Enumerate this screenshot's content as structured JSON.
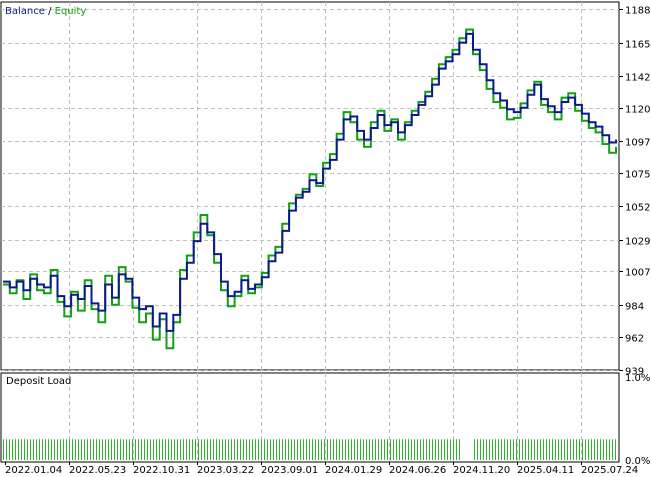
{
  "legend": {
    "balance": "Balance",
    "separator": " / ",
    "equity": "Equity"
  },
  "sub_title": "Deposit Load",
  "colors": {
    "balance": "#0a1a8c",
    "equity": "#11a011",
    "load": "#2fb32f",
    "grid": "#c0c0c0",
    "frame": "#000000"
  },
  "chart_data": [
    {
      "type": "line",
      "title": "",
      "x_ticks": [
        "2022.01.04",
        "2022.05.23",
        "2022.10.31",
        "2023.03.22",
        "2023.09.01",
        "2024.01.29",
        "2024.06.26",
        "2024.11.20",
        "2025.04.11",
        "2025.07.24"
      ],
      "y_ticks": [
        1188,
        1165,
        1142,
        1120,
        1097,
        1075,
        1052,
        1029,
        1007,
        984,
        962,
        939
      ],
      "ylim": [
        939,
        1193
      ],
      "grid": true,
      "series": [
        {
          "name": "Balance",
          "values": [
            1000,
            996,
            1000,
            994,
            1002,
            998,
            996,
            1004,
            990,
            983,
            991,
            988,
            997,
            985,
            980,
            998,
            989,
            1005,
            1002,
            989,
            981,
            983,
            969,
            978,
            966,
            977,
            1002,
            1013,
            1028,
            1040,
            1034,
            1019,
            1000,
            990,
            993,
            1001,
            995,
            998,
            1003,
            1014,
            1020,
            1035,
            1049,
            1058,
            1062,
            1070,
            1068,
            1078,
            1084,
            1098,
            1112,
            1114,
            1104,
            1098,
            1106,
            1115,
            1108,
            1110,
            1103,
            1108,
            1115,
            1122,
            1128,
            1136,
            1147,
            1152,
            1157,
            1165,
            1171,
            1160,
            1150,
            1139,
            1130,
            1125,
            1119,
            1117,
            1120,
            1129,
            1136,
            1126,
            1121,
            1117,
            1124,
            1127,
            1122,
            1116,
            1110,
            1107,
            1101,
            1096,
            1098
          ]
        },
        {
          "name": "Equity",
          "values": [
            998,
            992,
            1001,
            988,
            1005,
            994,
            992,
            1008,
            986,
            976,
            993,
            980,
            1001,
            981,
            972,
            1004,
            984,
            1010,
            1000,
            982,
            972,
            978,
            960,
            974,
            954,
            972,
            1008,
            1018,
            1034,
            1046,
            1032,
            1013,
            994,
            983,
            990,
            1004,
            992,
            996,
            1006,
            1018,
            1024,
            1040,
            1054,
            1060,
            1064,
            1074,
            1066,
            1082,
            1088,
            1102,
            1117,
            1110,
            1098,
            1093,
            1110,
            1118,
            1104,
            1112,
            1098,
            1110,
            1118,
            1124,
            1131,
            1140,
            1150,
            1155,
            1160,
            1168,
            1174,
            1157,
            1146,
            1133,
            1124,
            1120,
            1112,
            1113,
            1123,
            1132,
            1138,
            1122,
            1117,
            1112,
            1127,
            1130,
            1118,
            1111,
            1106,
            1103,
            1095,
            1089,
            1093
          ]
        }
      ]
    },
    {
      "type": "bar",
      "title": "Deposit Load",
      "y_ticks": [
        "1.0%",
        "0.0%"
      ],
      "ylim": [
        0,
        1.0
      ],
      "grid": true,
      "series": [
        {
          "name": "",
          "value_per_bar": 0.25
        }
      ]
    }
  ]
}
